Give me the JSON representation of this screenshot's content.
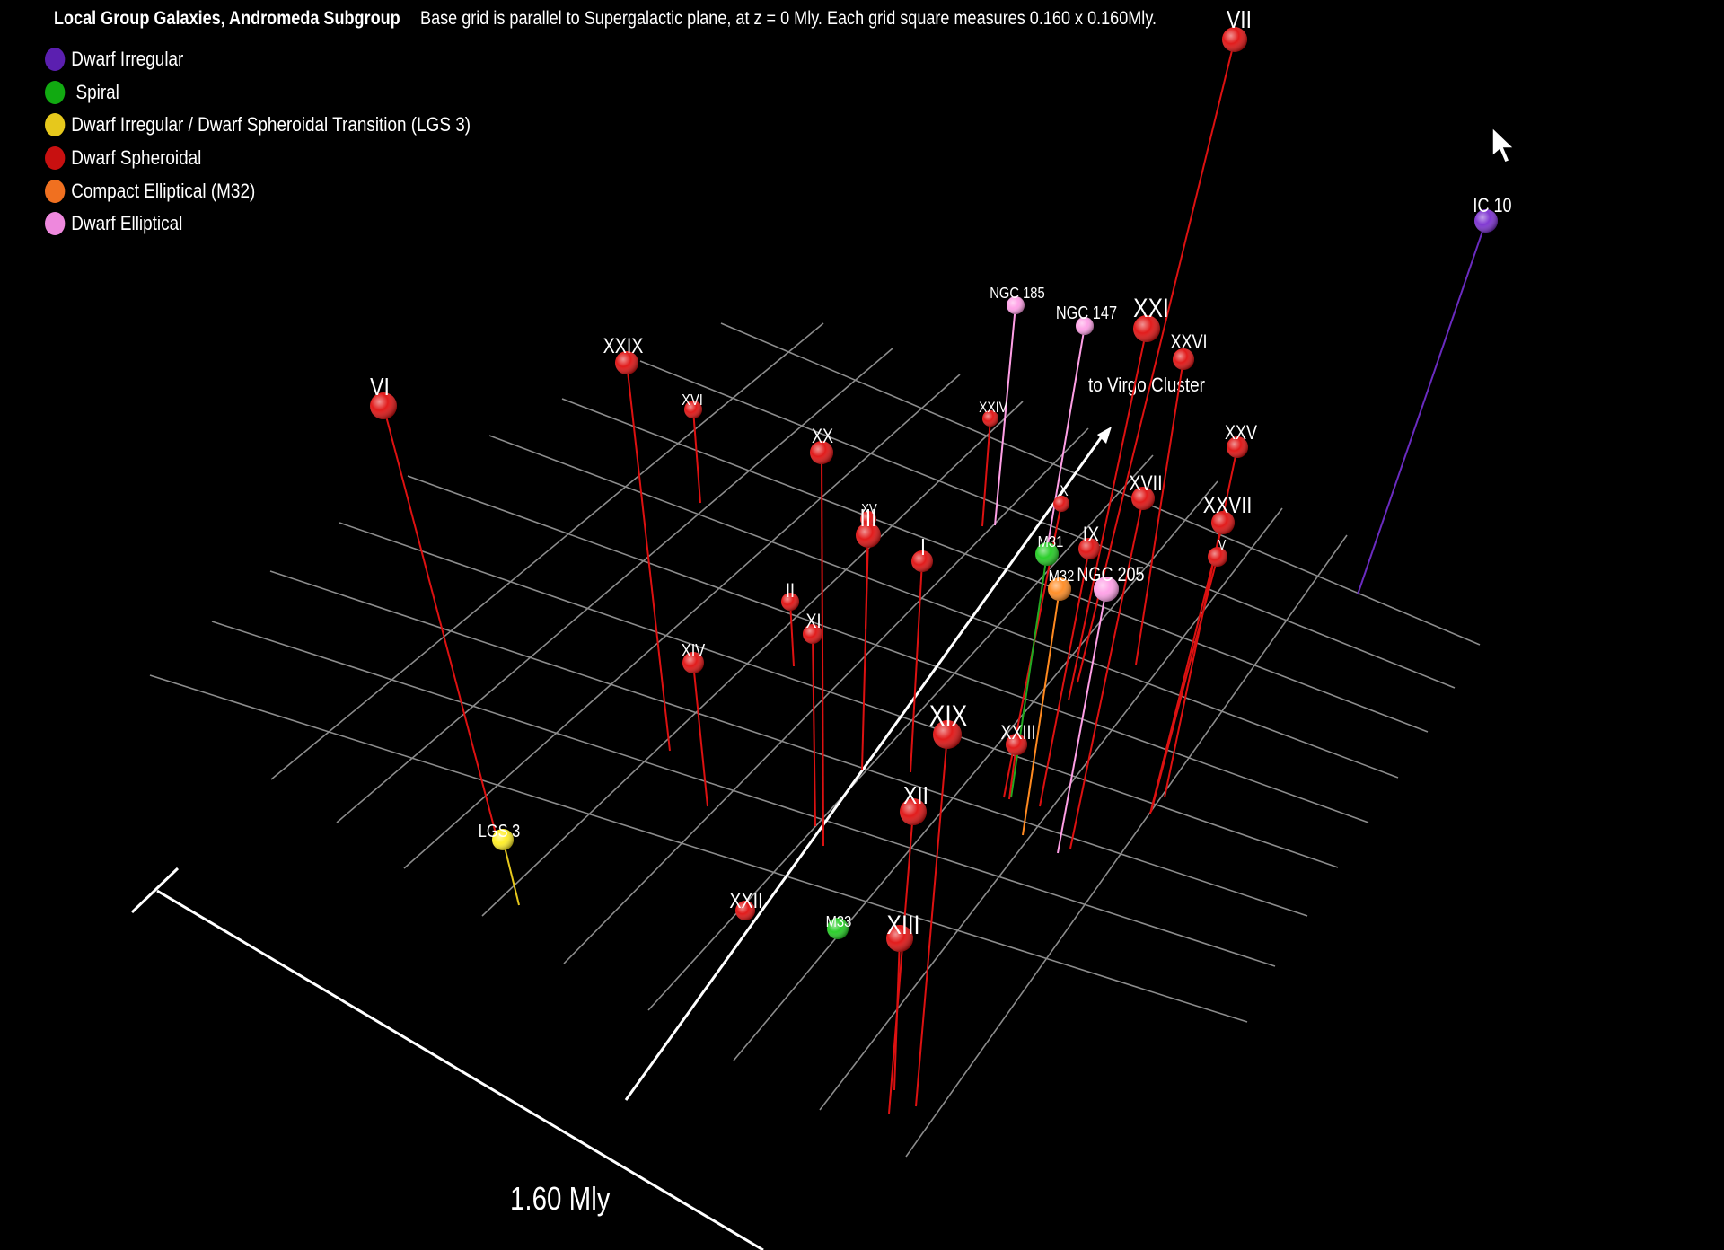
{
  "header": {
    "title": "Local Group Galaxies, Andromeda Subgroup",
    "subtitle": "Base grid is parallel to Supergalactic plane, at z = 0 Mly. Each grid square measures 0.160 x 0.160Mly."
  },
  "legend": [
    {
      "label": "Dwarf Irregular",
      "color": "#5b1fb0"
    },
    {
      "label": " Spiral",
      "color": "#11aa11"
    },
    {
      "label": "Dwarf Irregular / Dwarf Spheroidal Transition (LGS 3)",
      "color": "#e6c81c"
    },
    {
      "label": "Dwarf Spheroidal",
      "color": "#c81010"
    },
    {
      "label": "Compact Elliptical (M32)",
      "color": "#f07020"
    },
    {
      "label": "Dwarf Elliptical",
      "color": "#ee88dd"
    }
  ],
  "scale_label": "1.60 Mly",
  "direction_label": "to Virgo Cluster",
  "galaxies": [
    {
      "label": "VII",
      "type": "Dwarf Spheroidal",
      "color": "#e01010"
    },
    {
      "label": "IC 10",
      "type": "Dwarf Irregular",
      "color": "#7b2fd0"
    },
    {
      "label": "NGC 185",
      "type": "Dwarf Elliptical",
      "color": "#ff9fe6"
    },
    {
      "label": "NGC 147",
      "type": "Dwarf Elliptical",
      "color": "#ff9fe6"
    },
    {
      "label": "XXI",
      "type": "Dwarf Spheroidal",
      "color": "#e01010"
    },
    {
      "label": "XXVI",
      "type": "Dwarf Spheroidal",
      "color": "#e01010"
    },
    {
      "label": "XXIX",
      "type": "Dwarf Spheroidal",
      "color": "#e01010"
    },
    {
      "label": "VI",
      "type": "Dwarf Spheroidal",
      "color": "#e01010"
    },
    {
      "label": "XVI",
      "type": "Dwarf Spheroidal",
      "color": "#e01010"
    },
    {
      "label": "XXIV",
      "type": "Dwarf Spheroidal",
      "color": "#e01010"
    },
    {
      "label": "XX",
      "type": "Dwarf Spheroidal",
      "color": "#e01010"
    },
    {
      "label": "XXV",
      "type": "Dwarf Spheroidal",
      "color": "#e01010"
    },
    {
      "label": "X",
      "type": "Dwarf Spheroidal",
      "color": "#e01010"
    },
    {
      "label": "XVII",
      "type": "Dwarf Spheroidal",
      "color": "#e01010"
    },
    {
      "label": "XXVII",
      "type": "Dwarf Spheroidal",
      "color": "#e01010"
    },
    {
      "label": "XV",
      "type": "Dwarf Spheroidal",
      "color": "#e01010"
    },
    {
      "label": "III",
      "type": "Dwarf Spheroidal",
      "color": "#e01010"
    },
    {
      "label": "I",
      "type": "Dwarf Spheroidal",
      "color": "#e01010"
    },
    {
      "label": "IX",
      "type": "Dwarf Spheroidal",
      "color": "#e01010"
    },
    {
      "label": "M31",
      "type": "Spiral",
      "color": "#22cc22"
    },
    {
      "label": "V",
      "type": "Dwarf Spheroidal",
      "color": "#e01010"
    },
    {
      "label": "M32",
      "type": "Compact Elliptical",
      "color": "#ff8a20"
    },
    {
      "label": "NGC 205",
      "type": "Dwarf Elliptical",
      "color": "#ff9fe6"
    },
    {
      "label": "II",
      "type": "Dwarf Spheroidal",
      "color": "#e01010"
    },
    {
      "label": "XI",
      "type": "Dwarf Spheroidal",
      "color": "#e01010"
    },
    {
      "label": "XIV",
      "type": "Dwarf Spheroidal",
      "color": "#e01010"
    },
    {
      "label": "XIX",
      "type": "Dwarf Spheroidal",
      "color": "#e01010"
    },
    {
      "label": "XXIII",
      "type": "Dwarf Spheroidal",
      "color": "#e01010"
    },
    {
      "label": "XII",
      "type": "Dwarf Spheroidal",
      "color": "#e01010"
    },
    {
      "label": "LGS 3",
      "type": "Transition",
      "color": "#ffee22"
    },
    {
      "label": "XXII",
      "type": "Dwarf Spheroidal",
      "color": "#e01010"
    },
    {
      "label": "M33",
      "type": "Spiral",
      "color": "#22cc22"
    },
    {
      "label": "XIII",
      "type": "Dwarf Spheroidal",
      "color": "#e01010"
    }
  ]
}
